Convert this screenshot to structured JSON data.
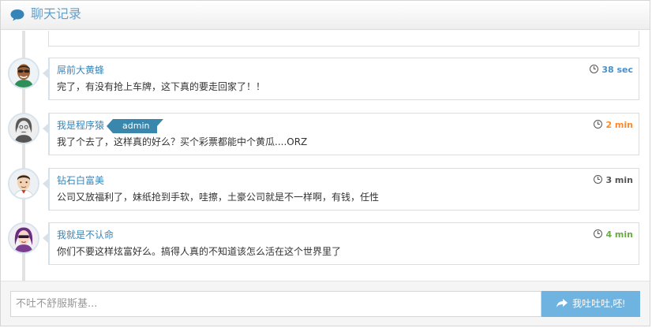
{
  "header": {
    "title": "聊天记录",
    "icon": "chat-bubble-icon"
  },
  "messages": [
    {
      "name": "屌前大黄蜂",
      "text": "完了，有没有抢上车牌，这下真的要走回家了！！",
      "time": "38 sec",
      "time_color": "#478fca",
      "badge": "",
      "avatar": "avatar-man-sunglasses-icon"
    },
    {
      "name": "我是程序猿",
      "text": "我了个去了，这样真的好么？买个彩票都能中个黄瓜....ORZ",
      "time": "2 min",
      "time_color": "#ff892a",
      "badge": "admin",
      "avatar": "avatar-man-long-hair-icon"
    },
    {
      "name": "钻石白富美",
      "text": "公司又放福利了，妹纸抢到手软，哇擦，土豪公司就是不一样啊，有钱，任性",
      "time": "3 min",
      "time_color": "#555555",
      "badge": "",
      "avatar": "avatar-man-short-hair-icon"
    },
    {
      "name": "我就是不认命",
      "text": "你们不要这样炫富好么。搞得人真的不知道该怎么活在这个世界里了",
      "time": "4 min",
      "time_color": "#69aa46",
      "badge": "",
      "avatar": "avatar-woman-purple-hair-icon"
    }
  ],
  "composer": {
    "placeholder": "不吐不舒服斯基...",
    "send_label": "我吐吐吐,呸!",
    "send_icon": "share-icon"
  }
}
